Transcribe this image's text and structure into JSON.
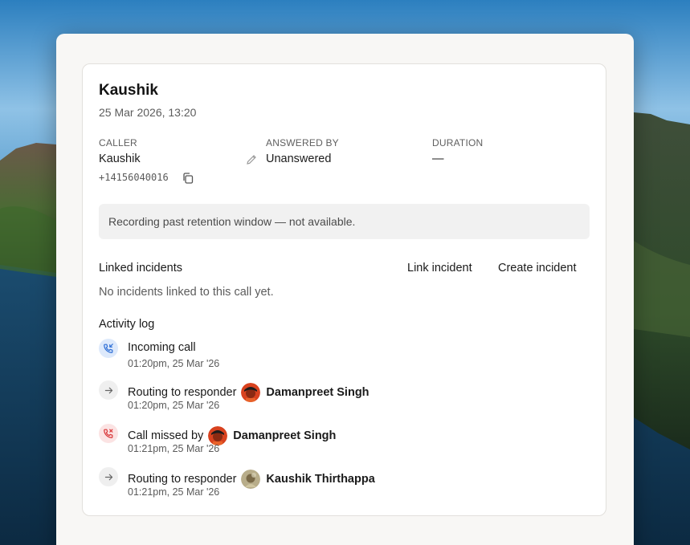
{
  "call": {
    "title": "Kaushik",
    "datetime": "25 Mar 2026, 13:20",
    "caller_label": "CALLER",
    "caller_name": "Kaushik",
    "caller_phone": "+14156040016",
    "answered_label": "ANSWERED BY",
    "answered_value": "Unanswered",
    "duration_label": "DURATION",
    "duration_value": "—"
  },
  "recording": {
    "message": "Recording past retention window — not available."
  },
  "incidents": {
    "title": "Linked incidents",
    "link_label": "Link incident",
    "create_label": "Create incident",
    "empty_text": "No incidents linked to this call yet."
  },
  "activity": {
    "title": "Activity log",
    "items": [
      {
        "icon": "incoming-call-icon",
        "text": "Incoming call",
        "person": "",
        "time": "01:20pm, 25 Mar '26"
      },
      {
        "icon": "arrow-right-icon",
        "text": "Routing to responder",
        "person": "Damanpreet Singh",
        "time": "01:20pm, 25 Mar '26"
      },
      {
        "icon": "missed-call-icon",
        "text": "Call missed by",
        "person": "Damanpreet Singh",
        "time": "01:21pm, 25 Mar '26"
      },
      {
        "icon": "arrow-right-icon",
        "text": "Routing to responder",
        "person": "Kaushik Thirthappa",
        "time": "01:21pm, 25 Mar '26"
      }
    ]
  },
  "colors": {
    "incoming_bg": "#dde9fb",
    "incoming_fg": "#2f6fd6",
    "missed_bg": "#fbe3e3",
    "missed_fg": "#d9383a",
    "neutral_bg": "#efefef"
  }
}
